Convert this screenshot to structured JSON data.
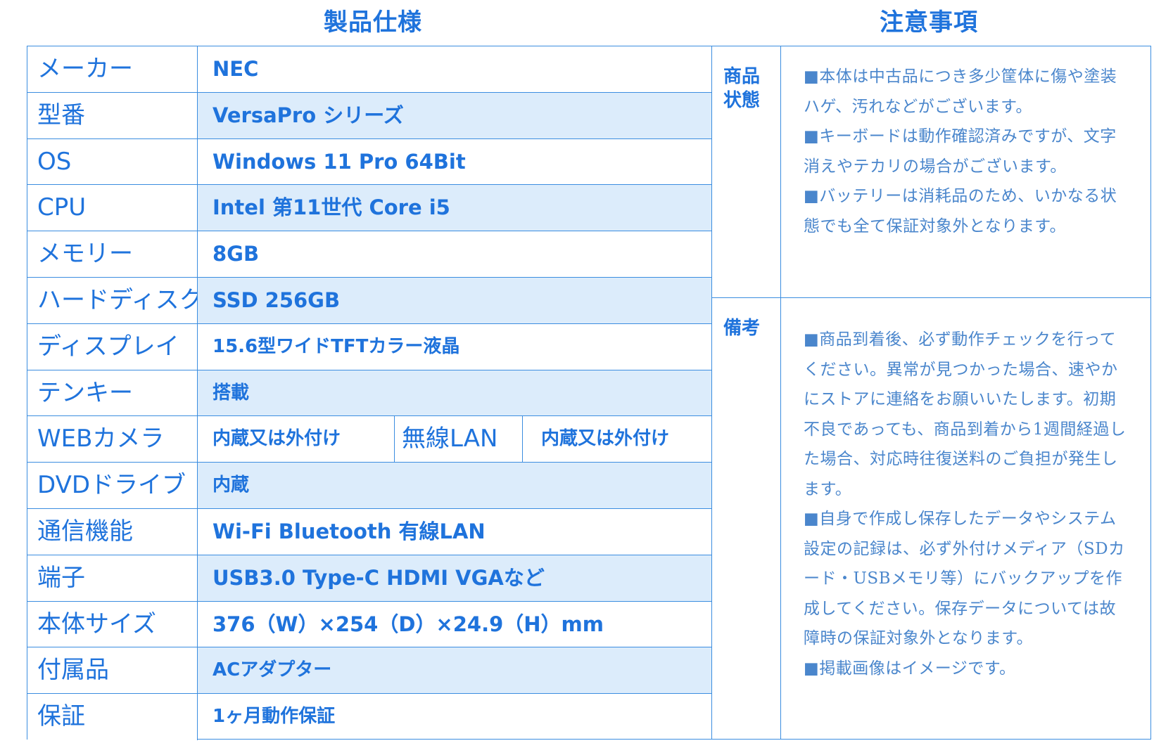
{
  "spec_heading": "製品仕様",
  "notes_heading": "注意事項",
  "specs": [
    {
      "label": "メーカー",
      "value": "NEC"
    },
    {
      "label": "型番",
      "value": "VersaPro シリーズ"
    },
    {
      "label": "OS",
      "value": "Windows 11 Pro 64Bit"
    },
    {
      "label": "CPU",
      "value": "Intel 第11世代 Core i5"
    },
    {
      "label": "メモリー",
      "value": "8GB"
    },
    {
      "label": "ハードディスク",
      "value": "SSD 256GB"
    },
    {
      "label": "ディスプレイ",
      "value": "15.6型ワイドTFTカラー液晶"
    },
    {
      "label": "テンキー",
      "value": "搭載"
    },
    {
      "label": "WEBカメラ",
      "value": "内蔵又は外付け",
      "label2": "無線LAN",
      "value2": "内蔵又は外付け"
    },
    {
      "label": "DVDドライブ",
      "value": "内蔵"
    },
    {
      "label": "通信機能",
      "value": "Wi-Fi Bluetooth 有線LAN"
    },
    {
      "label": "端子",
      "value": "USB3.0 Type-C HDMI VGAなど"
    },
    {
      "label": "本体サイズ",
      "value": "376（W）×254（D）×24.9（H）mm"
    },
    {
      "label": "付属品",
      "value": "ACアダプター"
    },
    {
      "label": "保証",
      "value": "1ヶ月動作保証"
    }
  ],
  "notes": {
    "condition": {
      "label_line1": "商品",
      "label_line2": "状態",
      "paragraphs": [
        "■本体は中古品につき多少筐体に傷や塗装ハゲ、汚れなどがございます。",
        "■キーボードは動作確認済みですが、文字消えやテカリの場合がございます。",
        "■バッテリーは消耗品のため、いかなる状態でも全て保証対象外となります。"
      ]
    },
    "remarks": {
      "label": "備考",
      "paragraphs": [
        "■商品到着後、必ず動作チェックを行ってください。異常が見つかった場合、速やかにストアに連絡をお願いいたします。初期不良であっても、商品到着から1週間経過した場合、対応時往復送料のご負担が発生します。",
        "■自身で作成し保存したデータやシステム設定の記録は、必ず外付けメディア（SDカード・USBメモリ等）にバックアップを作成してください。保存データについては故障時の保証対象外となります。",
        "■掲載画像はイメージです。"
      ]
    }
  }
}
